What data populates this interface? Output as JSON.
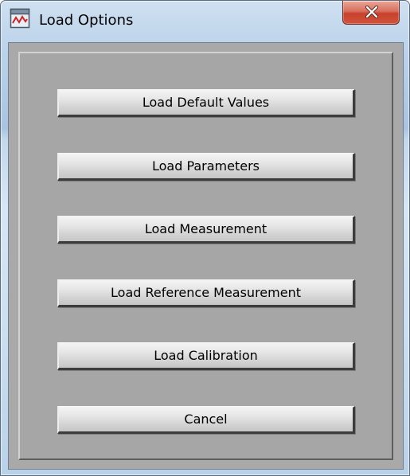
{
  "window": {
    "title": "Load Options",
    "app_icon": "labview-window-icon",
    "close_icon": "close-icon"
  },
  "buttons": [
    {
      "id": "load-default-values-button",
      "label": "Load Default Values"
    },
    {
      "id": "load-parameters-button",
      "label": "Load Parameters"
    },
    {
      "id": "load-measurement-button",
      "label": "Load Measurement"
    },
    {
      "id": "load-reference-measurement-button",
      "label": "Load Reference Measurement"
    },
    {
      "id": "load-calibration-button",
      "label": "Load Calibration"
    },
    {
      "id": "cancel-button",
      "label": "Cancel"
    }
  ],
  "colors": {
    "panel_gray": "#a6a6a6",
    "button_face": "#e0e0e0",
    "close_button_red": "#c7412c"
  }
}
